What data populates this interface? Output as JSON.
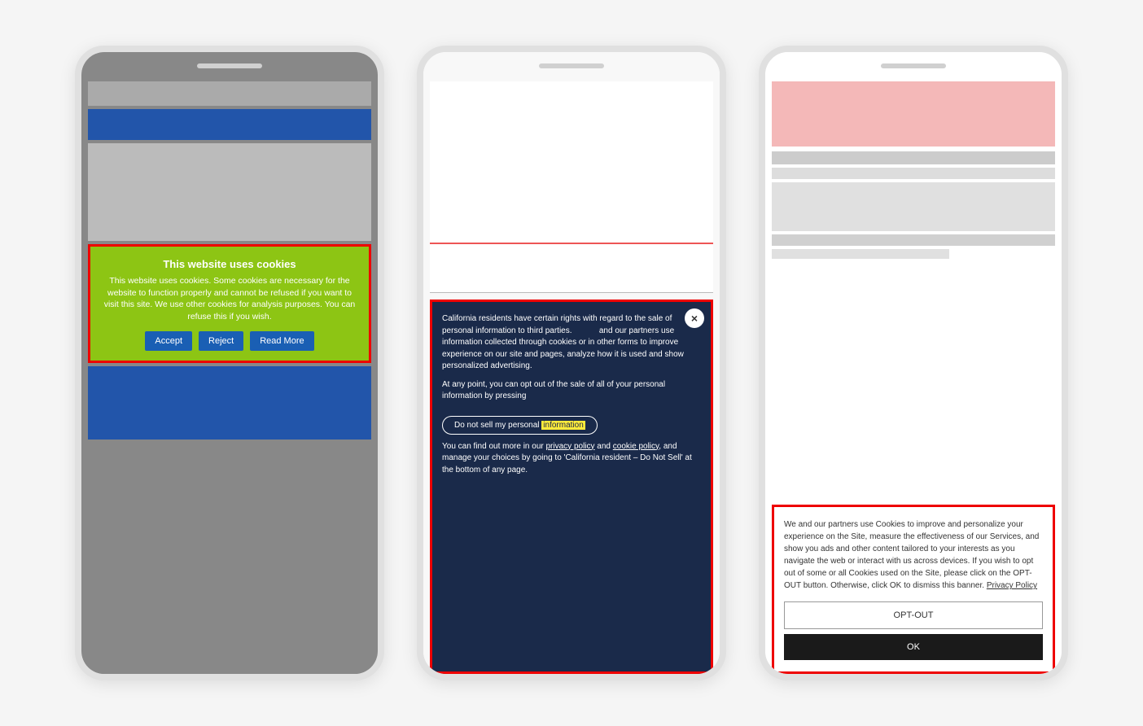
{
  "phone1": {
    "cookie_banner": {
      "title": "This website uses cookies",
      "text": "This website uses cookies. Some cookies are necessary for the website to function properly and cannot be refused if you want to visit this site. We use other cookies for analysis purposes. You can refuse this if you wish.",
      "accept_label": "Accept",
      "reject_label": "Reject",
      "read_more_label": "Read More"
    }
  },
  "phone2": {
    "ccpa_banner": {
      "close_label": "×",
      "text1": "California residents have certain rights with regard to the sale of personal information to third parties.                    and our partners use information collected through cookies or in other forms to improve experience on our site and pages, analyze how it is used and show personalized advertising.",
      "text2": "At any point, you can opt out of the sale of all of your personal information by pressing",
      "opt_out_label": "Do not sell my personal information",
      "text3": "You can find out more in our ",
      "privacy_policy_label": "privacy policy",
      "and_label": " and ",
      "cookie_policy_label": "cookie policy",
      "text4": ", and manage your choices by going to 'California resident – Do Not Sell' at the bottom of any page."
    }
  },
  "phone3": {
    "cookie_banner": {
      "text": "We and our partners use Cookies to improve and personalize your experience on the Site, measure the effectiveness of our Services, and show you ads and other content tailored to your interests as you navigate the web or interact with us across devices. If you wish to opt out of some or all Cookies used on the Site, please click on the OPT-OUT button. Otherwise, click OK to dismiss this banner.",
      "privacy_policy_label": "Privacy Policy",
      "opt_out_label": "OPT-OUT",
      "ok_label": "OK"
    }
  }
}
